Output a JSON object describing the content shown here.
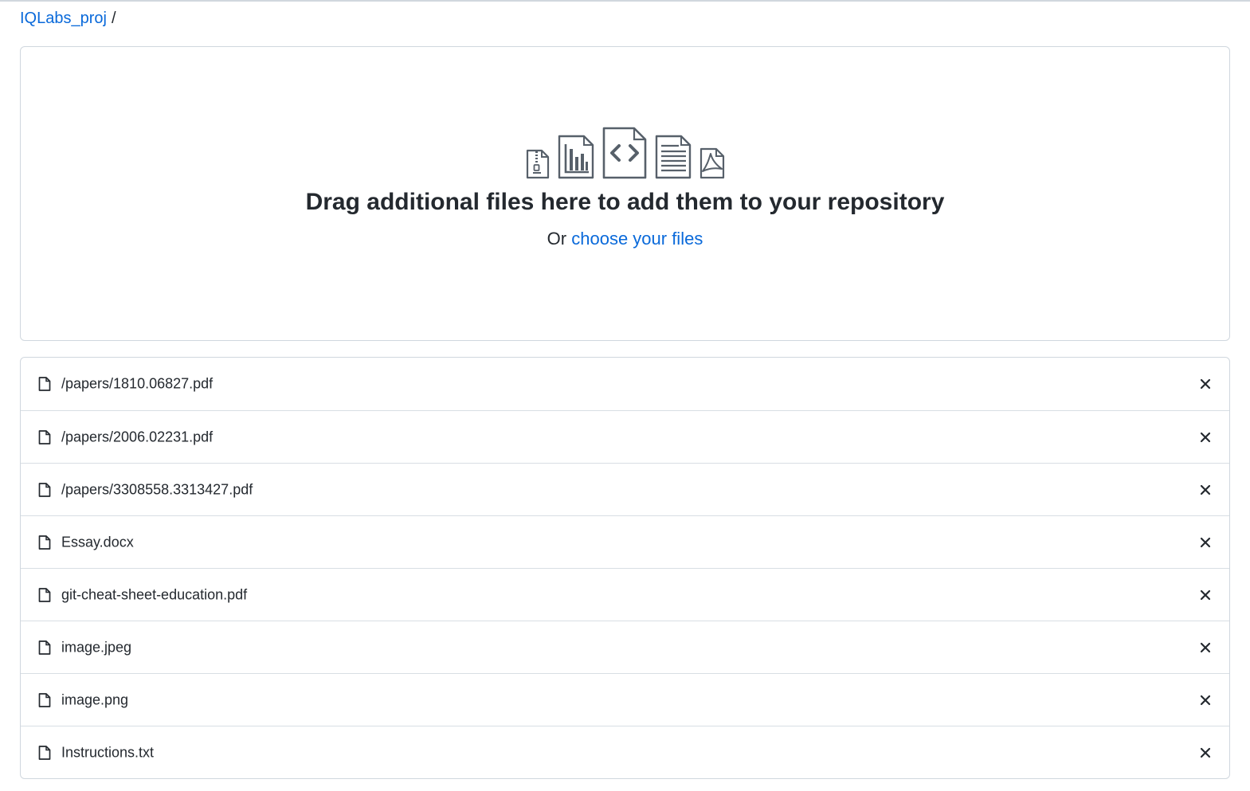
{
  "breadcrumb": {
    "repo": "IQLabs_proj",
    "separator": "/"
  },
  "dropzone": {
    "icons": [
      "file-zip-icon",
      "file-chart-icon",
      "file-code-icon",
      "file-text-icon",
      "file-pdf-icon"
    ],
    "title": "Drag additional files here to add them to your repository",
    "or_text": "Or",
    "choose_link": "choose your files"
  },
  "files": [
    {
      "name": "/papers/1810.06827.pdf",
      "icon": "file-icon",
      "remove_icon": "close-icon"
    },
    {
      "name": "/papers/2006.02231.pdf",
      "icon": "file-icon",
      "remove_icon": "close-icon"
    },
    {
      "name": "/papers/3308558.3313427.pdf",
      "icon": "file-icon",
      "remove_icon": "close-icon"
    },
    {
      "name": "Essay.docx",
      "icon": "file-icon",
      "remove_icon": "close-icon"
    },
    {
      "name": "git-cheat-sheet-education.pdf",
      "icon": "file-icon",
      "remove_icon": "close-icon"
    },
    {
      "name": "image.jpeg",
      "icon": "file-icon",
      "remove_icon": "close-icon"
    },
    {
      "name": "image.png",
      "icon": "file-icon",
      "remove_icon": "close-icon"
    },
    {
      "name": "Instructions.txt",
      "icon": "file-icon",
      "remove_icon": "close-icon"
    }
  ],
  "colors": {
    "link": "#0969da",
    "text": "#24292f",
    "border": "#d0d7de",
    "icon": "#57606a"
  }
}
